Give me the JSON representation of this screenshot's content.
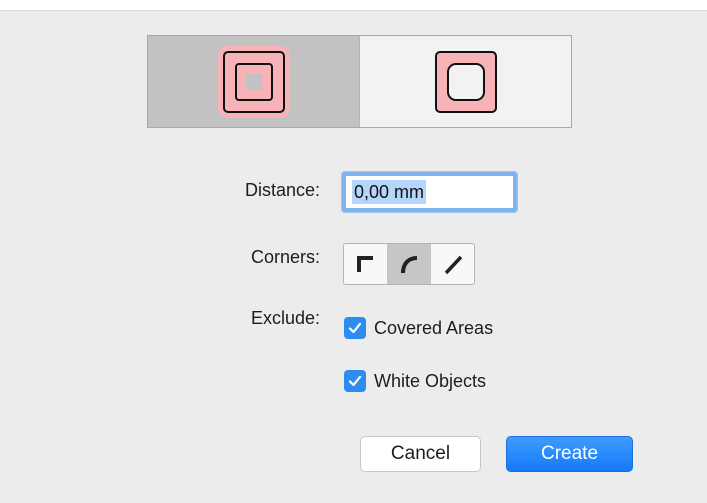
{
  "dialog": {
    "mode_selector": {
      "options": [
        {
          "icon": "outline-inside-icon",
          "selected": true
        },
        {
          "icon": "outline-outside-icon",
          "selected": false
        }
      ]
    },
    "distance": {
      "label": "Distance:",
      "value": "0,00 mm"
    },
    "corners": {
      "label": "Corners:",
      "options": [
        {
          "icon": "miter-corner-icon",
          "selected": false
        },
        {
          "icon": "round-corner-icon",
          "selected": true
        },
        {
          "icon": "bevel-corner-icon",
          "selected": false
        }
      ]
    },
    "exclude": {
      "label": "Exclude:",
      "covered_areas": {
        "label": "Covered Areas",
        "checked": true
      },
      "white_objects": {
        "label": "White Objects",
        "checked": true
      }
    },
    "buttons": {
      "cancel": "Cancel",
      "create": "Create"
    },
    "colors": {
      "accent": "#1479f7",
      "checkbox": "#2d8cf0",
      "shape_fill": "#f7b3b8",
      "focus_ring": "#7fb4ef"
    }
  }
}
